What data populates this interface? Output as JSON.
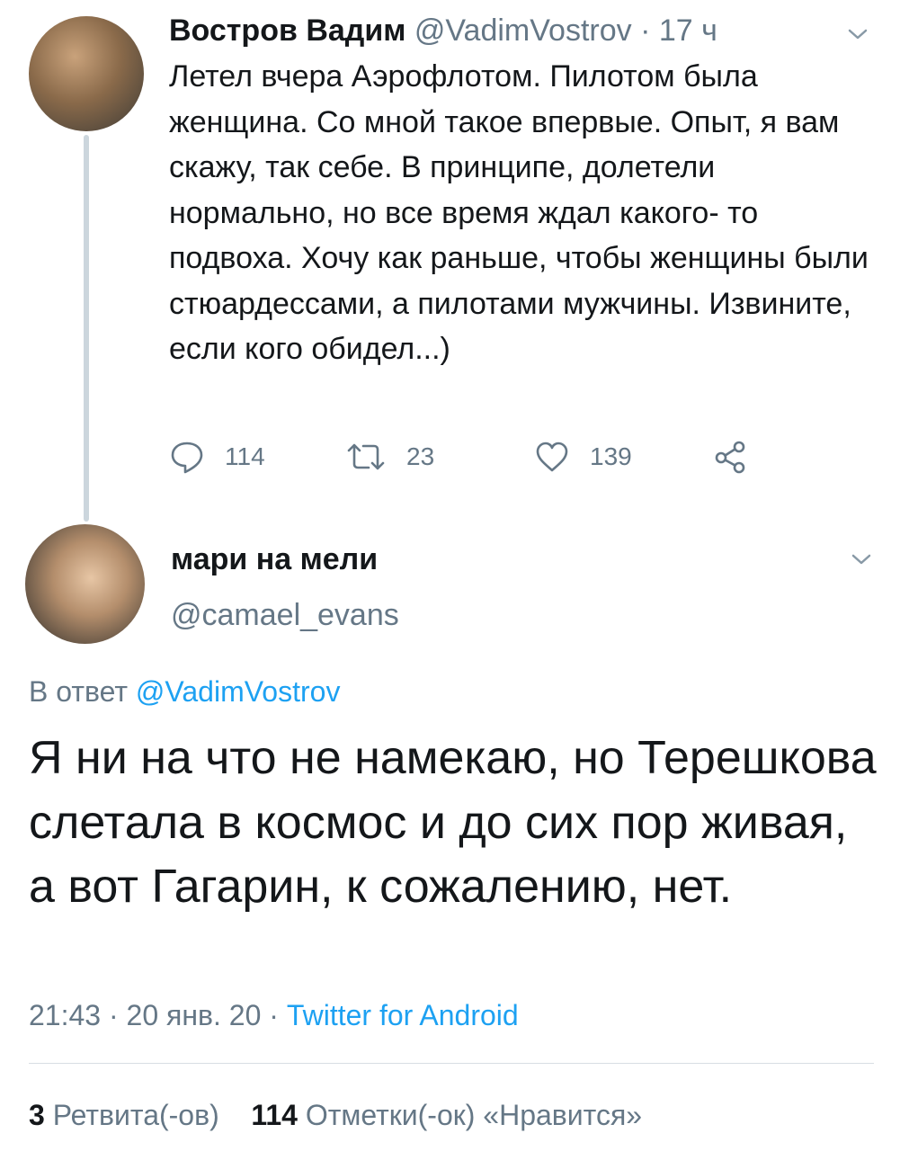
{
  "parent_tweet": {
    "author_name": "Востров Вадим",
    "handle": "@VadimVostrov",
    "separator": "·",
    "time_ago": "17 ч",
    "text": "Летел вчера Аэрофлотом. Пилотом была женщина. Со мной такое впервые. Опыт, я вам скажу, так себе. В принципе, долетели нормально, но все время ждал какого- то подвоха. Хочу как раньше, чтобы женщины были стюардессами, а пилотами мужчины. Извините, если кого обидел...)",
    "reply_count": "114",
    "retweet_count": "23",
    "like_count": "139",
    "icons": [
      "chevron-down-icon",
      "reply-icon",
      "retweet-icon",
      "like-icon",
      "share-icon"
    ]
  },
  "main_tweet": {
    "author_name": "мари на мели",
    "handle": "@camael_evans",
    "reply_prefix": "В ответ",
    "reply_to_handle": "@VadimVostrov",
    "text": "Я ни на что не намекаю, но Терешкова слетала в космос и до сих пор живая, а вот Гагарин, к сожалению, нет.",
    "time": "21:43",
    "date": "20 янв. 20",
    "separator": "·",
    "source": "Twitter for Android",
    "retweets_count": "3",
    "retweets_label": "Ретвита(-ов)",
    "likes_count": "114",
    "likes_label": "Отметки(-ок) «Нравится»"
  },
  "colors": {
    "text": "#14171a",
    "secondary": "#657786",
    "link": "#1da1f2",
    "divider": "#d7dee3",
    "thread_line": "#ccd6dd"
  }
}
